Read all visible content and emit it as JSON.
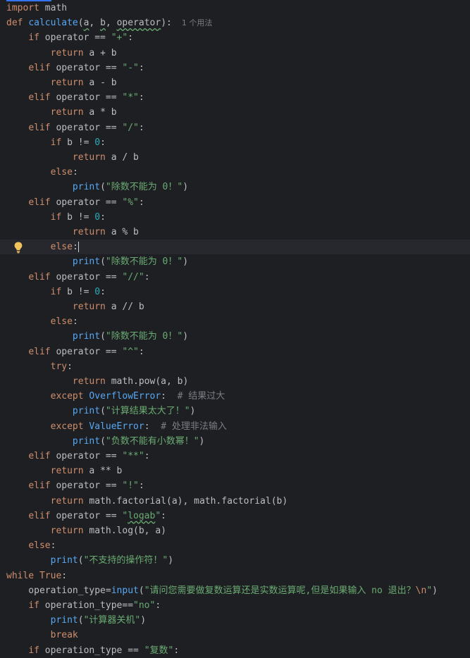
{
  "editor": {
    "usage_hint": "1 个用法",
    "lines": [
      {
        "t": "import math"
      },
      {
        "t": "def calculate(a, b, operator):"
      },
      {
        "t": "    if operator == \"+\":"
      },
      {
        "t": "        return a + b"
      },
      {
        "t": "    elif operator == \"-\":"
      },
      {
        "t": "        return a - b"
      },
      {
        "t": "    elif operator == \"*\":"
      },
      {
        "t": "        return a * b"
      },
      {
        "t": "    elif operator == \"/\":"
      },
      {
        "t": "        if b != 0:"
      },
      {
        "t": "            return a / b"
      },
      {
        "t": "        else:"
      },
      {
        "t": "            print(\"除数不能为 0！\")"
      },
      {
        "t": "    elif operator == \"%\":"
      },
      {
        "t": "        if b != 0:"
      },
      {
        "t": "            return a % b"
      },
      {
        "t": "        else:"
      },
      {
        "t": "            print(\"除数不能为 0！\")"
      },
      {
        "t": "    elif operator == \"//\":"
      },
      {
        "t": "        if b != 0:"
      },
      {
        "t": "            return a // b"
      },
      {
        "t": "        else:"
      },
      {
        "t": "            print(\"除数不能为 0！\")"
      },
      {
        "t": "    elif operator == \"^\":"
      },
      {
        "t": "        try:"
      },
      {
        "t": "            return math.pow(a, b)"
      },
      {
        "t": "        except OverflowError:  # 结果过大"
      },
      {
        "t": "            print(\"计算结果太大了！\")"
      },
      {
        "t": "        except ValueError:  # 处理非法输入"
      },
      {
        "t": "            print(\"负数不能有小数幂！\")"
      },
      {
        "t": "    elif operator == \"**\":"
      },
      {
        "t": "        return a ** b"
      },
      {
        "t": "    elif operator == \"!\":"
      },
      {
        "t": "        return math.factorial(a), math.factorial(b)"
      },
      {
        "t": "    elif operator == \"logab\":"
      },
      {
        "t": "        return math.log(b, a)"
      },
      {
        "t": "    else:"
      },
      {
        "t": "        print(\"不支持的操作符！\")"
      },
      {
        "t": "while True:"
      },
      {
        "t": "    operation_type=input(\"请问您需要做复数运算还是实数运算呢,但是如果输入 no 退出？\\n\")"
      },
      {
        "t": "    if operation_type==\"no\":"
      },
      {
        "t": "        print(\"计算器关机\")"
      },
      {
        "t": "        break"
      },
      {
        "t": "    if operation_type == \"复数\":"
      }
    ]
  },
  "gutter": {
    "bulb_icon": "lightbulb-icon",
    "bulb_line": 17
  },
  "colors": {
    "background": "#1e1f22",
    "keyword": "#cf8e6d",
    "function": "#56a8f5",
    "string": "#6aab73",
    "number": "#2aacb8",
    "comment": "#7a7e85",
    "text": "#bcbec4"
  }
}
